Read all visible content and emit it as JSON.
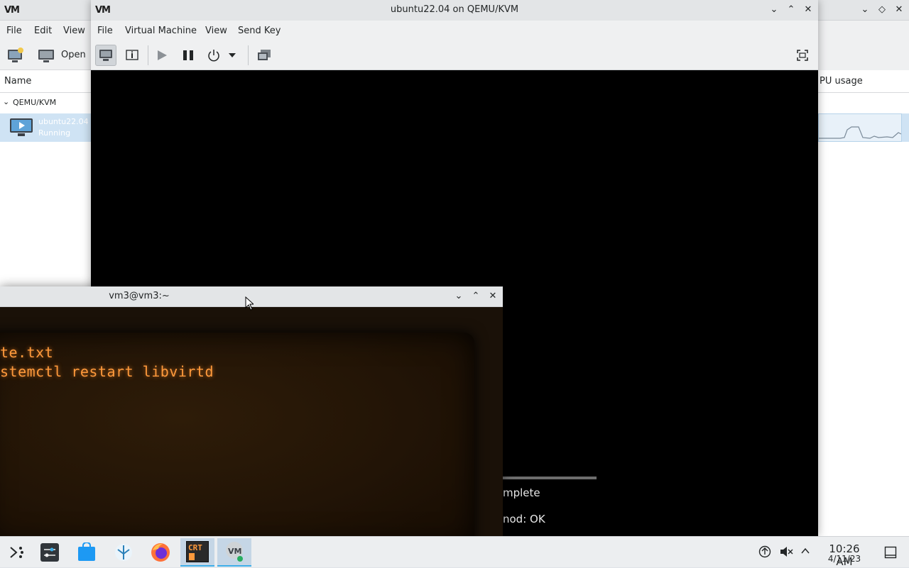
{
  "manager": {
    "menu": [
      "File",
      "Edit",
      "View"
    ],
    "toolbar_open_label": "Open",
    "column_name": "Name",
    "column_cpu": "PU usage",
    "connection": "QEMU/KVM",
    "vm_name": "ubuntu22.04",
    "vm_status": "Running"
  },
  "console": {
    "title": "ubuntu22.04 on QEMU/KVM",
    "menu": [
      "File",
      "Virtual Machine",
      "View",
      "Send Key"
    ],
    "guest_lines": [
      "mplete",
      "nod: OK"
    ]
  },
  "terminal": {
    "title": "vm3@vm3:~",
    "lines": [
      "te.txt",
      "stemctl restart libvirtd"
    ]
  },
  "taskbar": {
    "time": "10:26 AM",
    "date": "4/11/23",
    "crt_label": "CRT"
  },
  "colors": {
    "accent": "#3daee9",
    "selection": "#cfe3f4",
    "crt_text": "#ff9a3c"
  }
}
